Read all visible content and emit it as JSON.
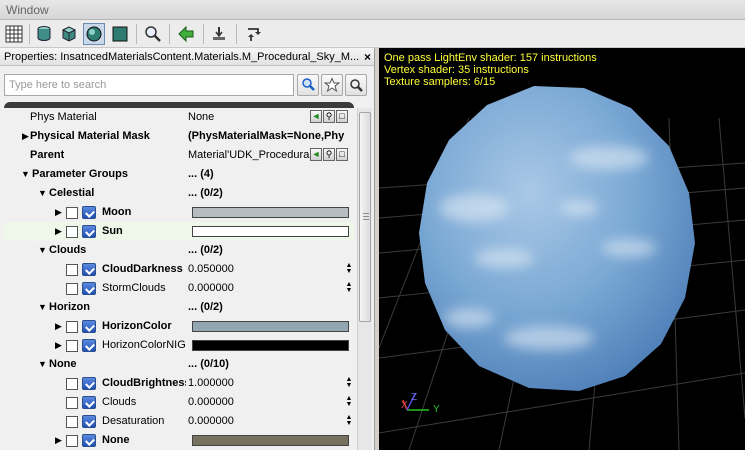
{
  "window": {
    "title": "Window"
  },
  "toolbar": {
    "buttons": [
      {
        "name": "grid-icon"
      },
      {
        "name": "cylinder-icon"
      },
      {
        "name": "cube-icon"
      },
      {
        "name": "sphere-icon"
      },
      {
        "name": "plane-icon"
      },
      {
        "name": "zoom-icon"
      },
      {
        "name": "back-arrow-icon"
      },
      {
        "name": "realtime-icon"
      },
      {
        "name": "refresh-icon"
      }
    ],
    "active": "sphere-icon"
  },
  "properties": {
    "title": "Properties: InsatncedMaterialsContent.Materials.M_Procedural_Sky_M...",
    "close_label": "×",
    "search_placeholder": "Type here to search",
    "rows": [
      {
        "name": "Phys Material",
        "value": "None",
        "indent": 26,
        "bold": false
      },
      {
        "name": "Physical Material Mask",
        "value": "(PhysMaterialMask=None,Phy",
        "indent": 26,
        "bold": true,
        "expand": "right"
      },
      {
        "name": "Parent",
        "value": "Material'UDK_ProceduralS",
        "indent": 26,
        "bold": true
      },
      {
        "name": "Parameter Groups",
        "value": "... (4)",
        "indent": 28,
        "bold": true,
        "expand": "down"
      },
      {
        "name": "Celestial",
        "value": "... (0/2)",
        "indent": 45,
        "bold": true,
        "expand": "down"
      },
      {
        "name": "Moon",
        "value": "",
        "indent": 98,
        "bold": true,
        "expand": "right",
        "check": true
      },
      {
        "name": "Sun",
        "value": "",
        "indent": 98,
        "bold": true,
        "expand": "right",
        "check": true
      },
      {
        "name": "Clouds",
        "value": "... (0/2)",
        "indent": 45,
        "bold": true,
        "expand": "down"
      },
      {
        "name": "CloudDarkness",
        "value": "0.050000",
        "indent": 98,
        "bold": true,
        "check": true
      },
      {
        "name": "StormClouds",
        "value": "0.000000",
        "indent": 98,
        "bold": false,
        "check": true
      },
      {
        "name": "Horizon",
        "value": "... (0/2)",
        "indent": 45,
        "bold": true,
        "expand": "down"
      },
      {
        "name": "HorizonColor",
        "value": "",
        "indent": 98,
        "bold": true,
        "expand": "right",
        "check": true
      },
      {
        "name": "HorizonColorNIGHT",
        "value": "",
        "indent": 98,
        "bold": false,
        "expand": "right",
        "check": true
      },
      {
        "name": "None",
        "value": "... (0/10)",
        "indent": 45,
        "bold": true,
        "expand": "down"
      },
      {
        "name": "CloudBrightness",
        "value": "1.000000",
        "indent": 98,
        "bold": true,
        "check": true
      },
      {
        "name": "Clouds",
        "value": "0.000000",
        "indent": 98,
        "bold": false,
        "check": true
      },
      {
        "name": "Desaturation",
        "value": "0.000000",
        "indent": 98,
        "bold": false,
        "check": true
      },
      {
        "name": "None",
        "value": "",
        "indent": 98,
        "bold": true,
        "expand": "right",
        "check": true
      }
    ],
    "colors": {
      "moon_swatch": "#b7bcc1",
      "sun_swatch": "#ffffff",
      "horizon_swatch": "#93a7b3",
      "horizon_night_swatch": "#000000",
      "none_swatch": "#77725e"
    }
  },
  "viewport": {
    "stats": [
      "One pass LightEnv shader: 157 instructions",
      "Vertex shader: 35 instructions",
      "Texture samplers: 6/15"
    ],
    "axis_labels": {
      "x": "X",
      "y": "Y",
      "z": "Z"
    },
    "stats_color": "#ffff3a"
  }
}
